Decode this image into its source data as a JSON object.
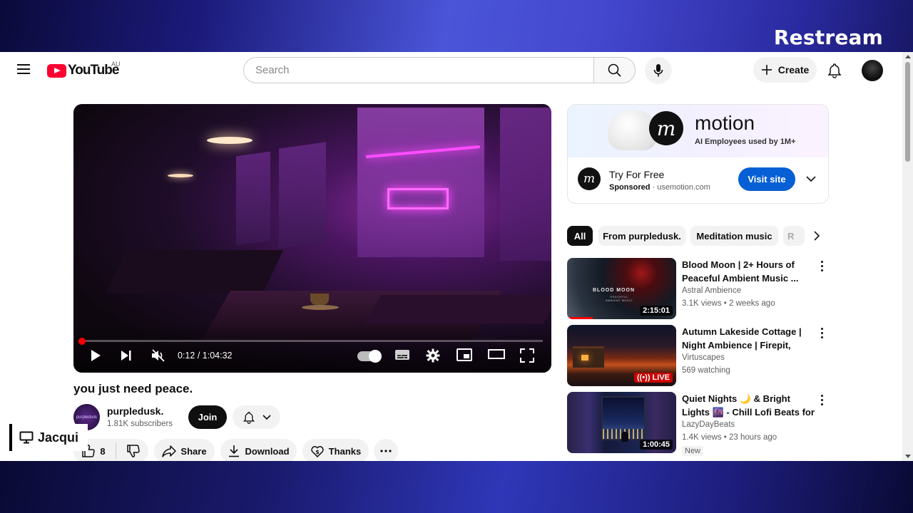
{
  "overlay": {
    "brand": "Restream",
    "viewer_name": "Jacqui"
  },
  "header": {
    "logo_text": "YouTube",
    "country_code": "AU",
    "search_placeholder": "Search",
    "create_label": "Create"
  },
  "player": {
    "current_time": "0:12",
    "duration": "1:04:32",
    "progress_fraction": 0.003
  },
  "video": {
    "title": "you just need peace.",
    "channel_name": "purpledusk.",
    "channel_avatar_text": "purpledusk",
    "subscribers": "1.81K subscribers",
    "join_label": "Join",
    "likes": "8",
    "share_label": "Share",
    "download_label": "Download",
    "thanks_label": "Thanks"
  },
  "ad": {
    "brand": "motion",
    "tagline": "AI Employees used by 1M+",
    "cta_title": "Try For Free",
    "sponsored_label": "Sponsored",
    "domain": "usemotion.com",
    "button_label": "Visit site"
  },
  "chips": [
    "All",
    "From purpledusk.",
    "Meditation music",
    "R"
  ],
  "recommendations": [
    {
      "title": "Blood Moon | 2+ Hours of Peaceful Ambient Music ...",
      "thumb_text": "BLOOD MOON",
      "thumb_sub": "PEACEFUL AMBIENT MUSIC",
      "channel": "Astral Ambience",
      "stats": "3.1K views • 2 weeks ago",
      "duration": "2:15:01"
    },
    {
      "title": "Autumn Lakeside Cottage | Night Ambience | Firepit, Lake,...",
      "channel": "Virtuscapes",
      "stats": "569 watching",
      "live_label": "LIVE"
    },
    {
      "title": "Quiet Nights 🌙 & Bright Lights 🌆 - Chill Lofi Beats for Study ...",
      "channel": "LazyDayBeats",
      "stats": "1.4K views • 23 hours ago",
      "duration": "1:00:45",
      "badge": "New"
    }
  ]
}
